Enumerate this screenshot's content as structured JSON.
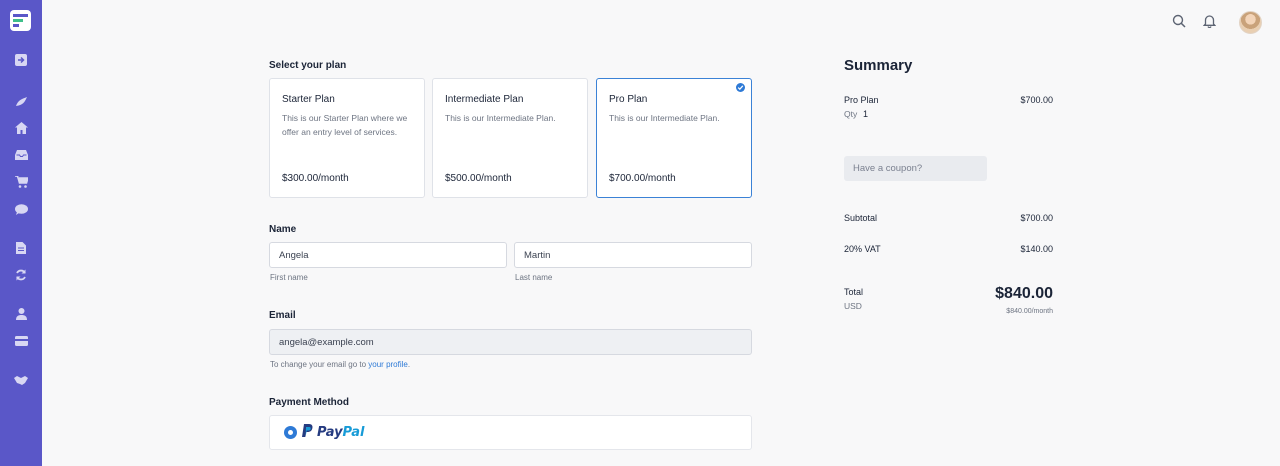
{
  "header": {
    "icons": [
      "search-icon",
      "bell-icon",
      "avatar"
    ]
  },
  "sidebar": {
    "icons": [
      "logo",
      "logout-icon",
      "fire-icon",
      "home-icon",
      "inbox-icon",
      "cart-icon",
      "chat-icon",
      "document-icon",
      "sync-icon",
      "user-icon",
      "credit-card-icon",
      "handshake-icon"
    ]
  },
  "plans": {
    "title": "Select your plan",
    "items": [
      {
        "name": "Starter Plan",
        "description": "This is our Starter Plan where we offer an entry level of services.",
        "price": "$300.00/month",
        "selected": false
      },
      {
        "name": "Intermediate Plan",
        "description": "This is our Intermediate Plan.",
        "price": "$500.00/month",
        "selected": false
      },
      {
        "name": "Pro Plan",
        "description": "This is our Intermediate Plan.",
        "price": "$700.00/month",
        "selected": true
      }
    ]
  },
  "name": {
    "label": "Name",
    "first_name": "Angela",
    "last_name": "Martin",
    "first_hint": "First name",
    "last_hint": "Last name"
  },
  "email": {
    "label": "Email",
    "value": "angela@example.com",
    "hint_prefix": "To change your email go to ",
    "hint_link": "your profile",
    "hint_suffix": "."
  },
  "payment": {
    "label": "Payment Method",
    "method_pay": "Pay",
    "method_pal": "Pal"
  },
  "summary": {
    "title": "Summary",
    "item_name": "Pro Plan",
    "item_price": "$700.00",
    "qty_label": "Qty",
    "qty_value": "1",
    "coupon_placeholder": "Have a coupon?",
    "subtotal_label": "Subtotal",
    "subtotal_value": "$700.00",
    "vat_label": "20% VAT",
    "vat_value": "$140.00",
    "total_label": "Total",
    "currency": "USD",
    "total_value": "$840.00",
    "total_per_month": "$840.00/month"
  },
  "colors": {
    "sidebar": "#5a57c8",
    "accent": "#2e7ad6"
  }
}
